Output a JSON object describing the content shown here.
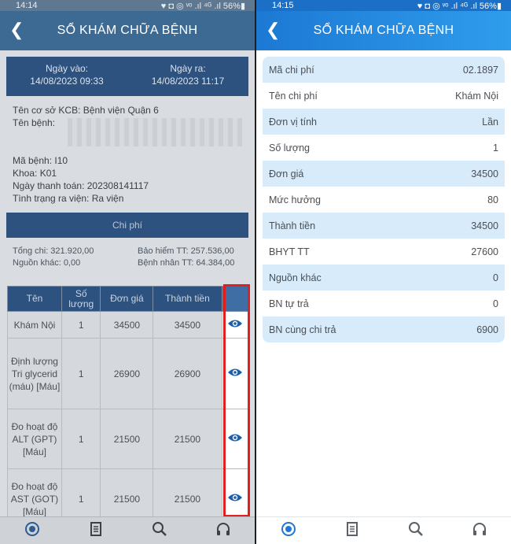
{
  "left": {
    "status": {
      "time": "14:14",
      "icons": "♥ ◘ ◎ ᵛᵒ .ıl ⁴ᴳ .ıl 56%▮"
    },
    "header": {
      "title": "SỔ KHÁM CHỮA BỆNH"
    },
    "dates": {
      "in_label": "Ngày vào:",
      "in_value": "14/08/2023 09:33",
      "out_label": "Ngày ra:",
      "out_value": "14/08/2023 11:17"
    },
    "info": {
      "facility": "Tên cơ sở KCB:  Bệnh viện Quận 6",
      "disease_name": "Tên bệnh:",
      "disease_code": "Mã bệnh: I10",
      "department": "Khoa: K01",
      "payment_date": "Ngày thanh toán: 202308141117",
      "discharge_status": "Tình trạng ra viện: Ra viện"
    },
    "cost_title": "Chi phí",
    "costs": {
      "total": "Tổng chi: 321.920,00",
      "insurance": "Bảo hiểm TT: 257.536,00",
      "other": "Nguồn khác: 0,00",
      "patient": "Bệnh nhân TT: 64.384,00"
    },
    "table": {
      "headers": [
        "Tên",
        "Số lượng",
        "Đơn giá",
        "Thành tiền"
      ],
      "rows": [
        {
          "name": "Khám Nội",
          "qty": "1",
          "price": "34500",
          "total": "34500"
        },
        {
          "name": "Định lượng Tri glycerid (máu) [Máu]",
          "qty": "1",
          "price": "26900",
          "total": "26900"
        },
        {
          "name": "Đo hoạt độ ALT (GPT) [Máu]",
          "qty": "1",
          "price": "21500",
          "total": "21500"
        },
        {
          "name": "Đo hoạt độ AST (GOT) [Máu]",
          "qty": "1",
          "price": "21500",
          "total": "21500"
        }
      ]
    }
  },
  "right": {
    "status": {
      "time": "14:15",
      "icons": "♥ ◘ ◎ ᵛᵒ .ıl ⁴ᴳ .ıl 56%▮"
    },
    "header": {
      "title": "SỔ KHÁM CHỮA BỆNH"
    },
    "details": [
      {
        "label": "Mã chi phí",
        "value": "02.1897"
      },
      {
        "label": "Tên chi phí",
        "value": "Khám Nội"
      },
      {
        "label": "Đơn vị tính",
        "value": "Lần"
      },
      {
        "label": "Số lượng",
        "value": "1"
      },
      {
        "label": "Đơn giá",
        "value": "34500"
      },
      {
        "label": "Mức hưởng",
        "value": "80"
      },
      {
        "label": "Thành tiền",
        "value": "34500"
      },
      {
        "label": "BHYT TT",
        "value": "27600"
      },
      {
        "label": "Nguồn khác",
        "value": "0"
      },
      {
        "label": "BN tự trả",
        "value": "0"
      },
      {
        "label": "BN cùng chi trả",
        "value": "6900"
      }
    ]
  },
  "tabbar": {
    "icons": [
      "medal-icon",
      "document-icon",
      "magnifier-icon",
      "headset-icon"
    ]
  },
  "colors": {
    "accent": "#1c79d4",
    "highlight_row": "#d7ebfb",
    "annotation": "#e02020"
  }
}
